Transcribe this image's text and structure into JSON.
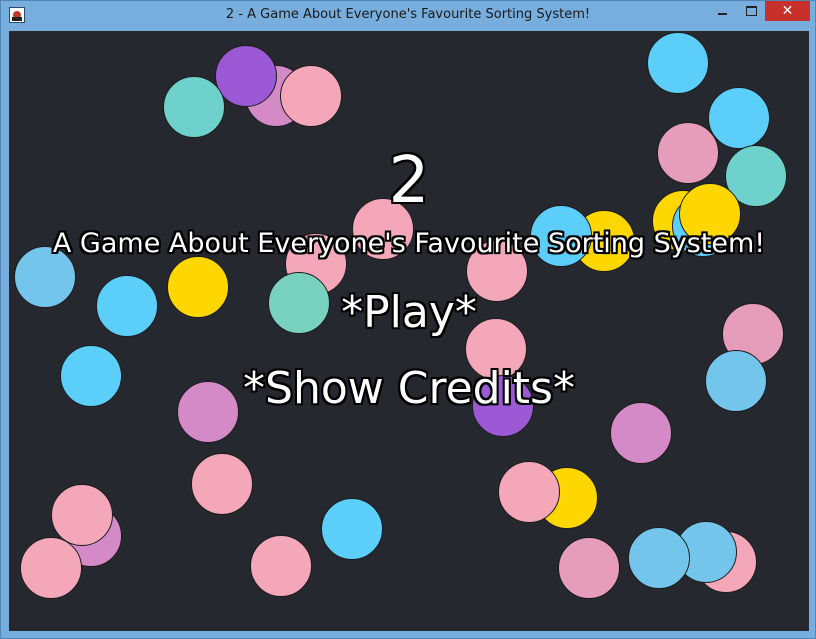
{
  "window": {
    "title": "2 - A Game About Everyone's Favourite Sorting System!",
    "app_icon": "game-app-icon",
    "controls": {
      "minimize": "minimize-icon",
      "maximize": "maximize-icon",
      "close": "✕"
    }
  },
  "game": {
    "background_color": "#26282f",
    "title": "2",
    "subtitle": "A Game About Everyone's Favourite Sorting System!",
    "menu": {
      "play": "*Play*",
      "show_credits": "*Show Credits*"
    },
    "ball_colors": {
      "purple": "#9b59d6",
      "teal": "#6fd1cb",
      "pink": "#f4a7b9",
      "blue": "#5bcefa",
      "yellow": "#ffd700",
      "mint": "#79d2bf",
      "mauve": "#d48ac7",
      "rose": "#e69dba",
      "sky": "#73c5ec"
    }
  }
}
